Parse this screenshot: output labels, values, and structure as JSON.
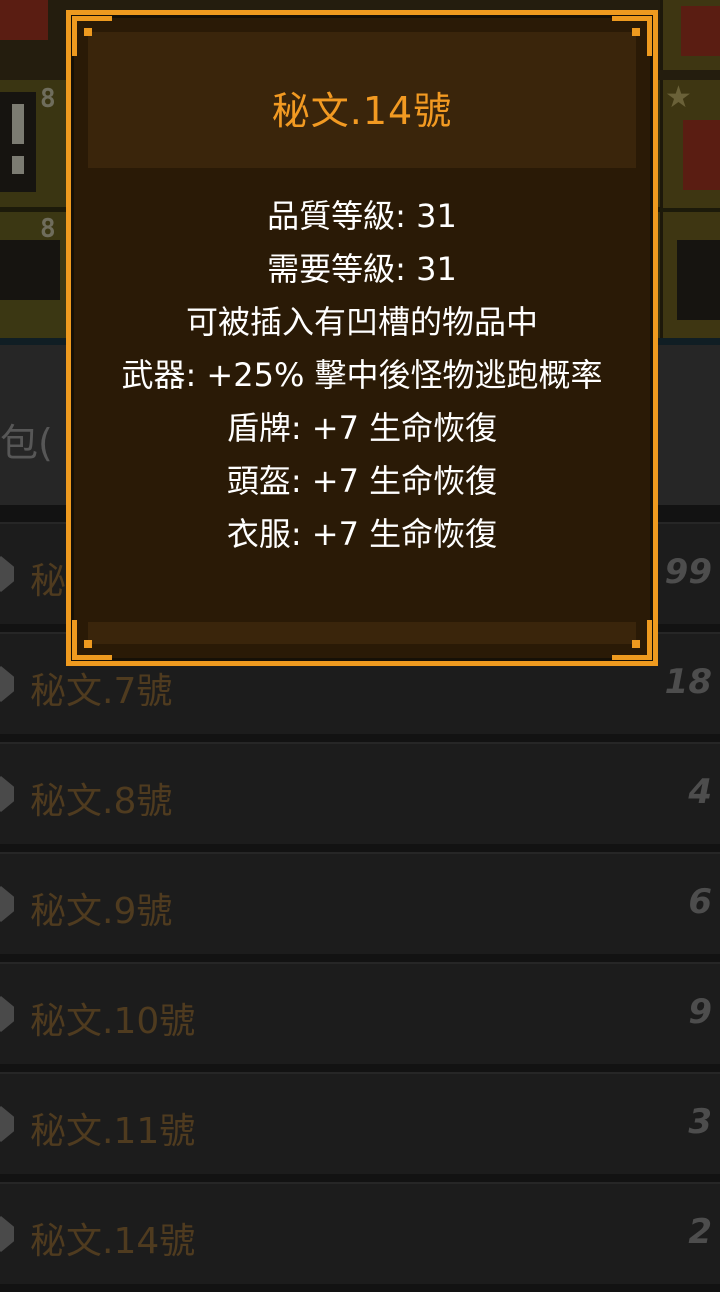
{
  "background": {
    "slot_numbers": [
      "8",
      "8"
    ],
    "bag_label": "包("
  },
  "inventory": {
    "items": [
      {
        "name": "秘",
        "count": "99"
      },
      {
        "name": "秘文.7號",
        "count": "18"
      },
      {
        "name": "秘文.8號",
        "count": "4"
      },
      {
        "name": "秘文.9號",
        "count": "6"
      },
      {
        "name": "秘文.10號",
        "count": "9"
      },
      {
        "name": "秘文.11號",
        "count": "3"
      },
      {
        "name": "秘文.14號",
        "count": "2"
      }
    ]
  },
  "tooltip": {
    "title": "秘文.14號",
    "lines": [
      "品質等級: 31",
      "需要等級: 31",
      "可被插入有凹槽的物品中",
      "武器: +25% 擊中後怪物逃跑概率",
      "盾牌: +7 生命恢復",
      "頭盔: +7 生命恢復",
      "衣服: +7 生命恢復"
    ]
  },
  "colors": {
    "tooltip_border": "#ee9a1f",
    "tooltip_title": "#f29a22",
    "tooltip_bg": "#2a1a06",
    "item_name": "#4f3b1f"
  }
}
